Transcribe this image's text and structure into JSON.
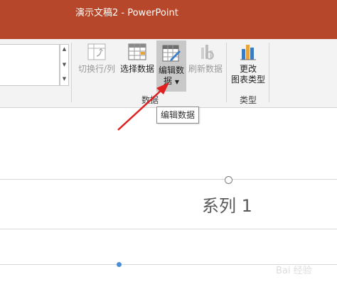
{
  "window": {
    "title": "演示文稿2 - PowerPoint"
  },
  "ribbon": {
    "buttons": {
      "switch_row_col": "切换行/列",
      "select_data": "选择数据",
      "edit_data_line1": "编辑数",
      "edit_data_line2": "据",
      "refresh_data": "刷新数据",
      "change_type_line1": "更改",
      "change_type_line2": "图表类型"
    },
    "groups": {
      "data": "数据",
      "type": "类型"
    }
  },
  "tooltip": {
    "text": "编辑数据"
  },
  "slide": {
    "series_label": "系列 1"
  },
  "watermark": {
    "text": "Bai 经验"
  },
  "colors": {
    "titlebar": "#b7472a",
    "annotation_arrow": "#e02020",
    "data_point": "#4a8fd6"
  },
  "icons": [
    "switch-row-col-icon",
    "select-data-icon",
    "edit-data-icon",
    "refresh-data-icon",
    "change-chart-type-icon"
  ]
}
